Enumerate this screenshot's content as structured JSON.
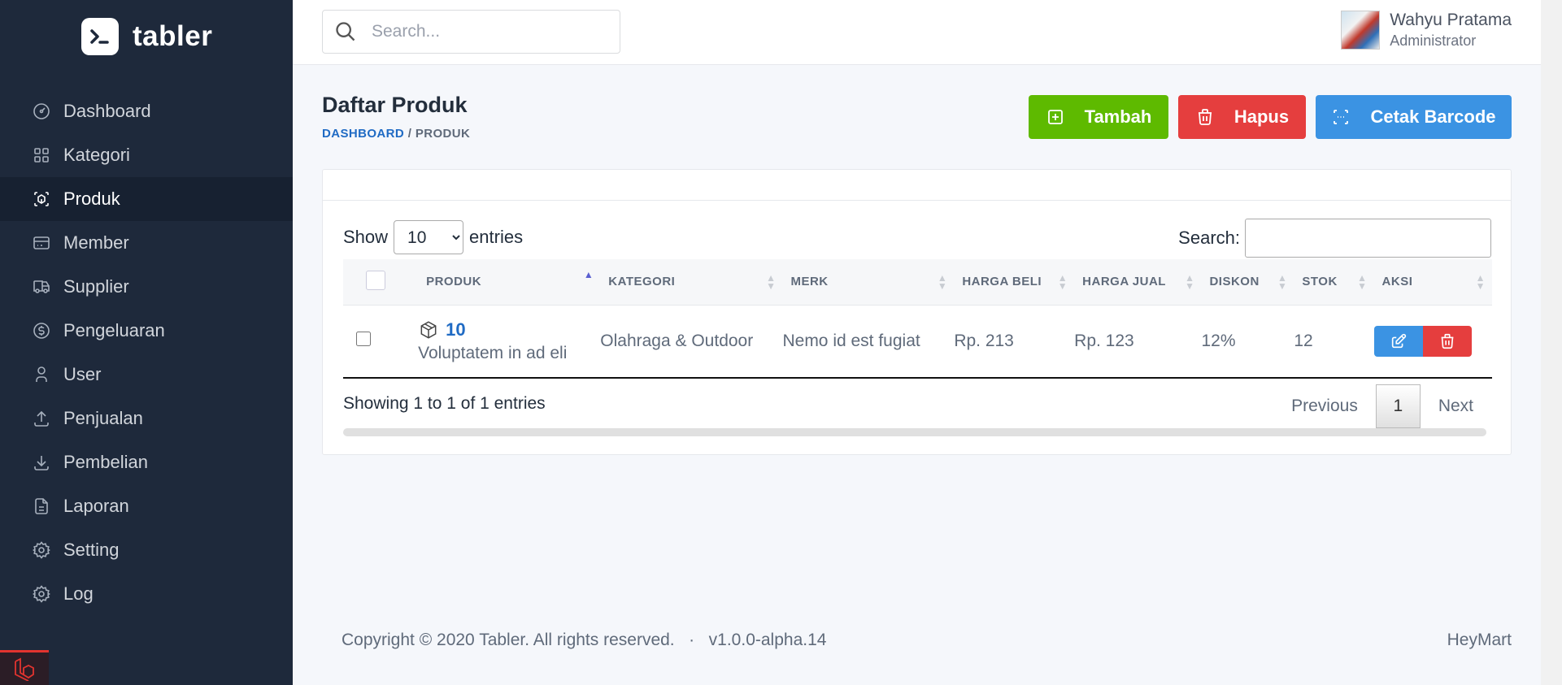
{
  "brand": {
    "name": "tabler"
  },
  "sidebar": {
    "items": [
      {
        "label": "Dashboard",
        "icon": "dashboard-icon"
      },
      {
        "label": "Kategori",
        "icon": "grid-icon"
      },
      {
        "label": "Produk",
        "icon": "box-icon",
        "active": true
      },
      {
        "label": "Member",
        "icon": "card-icon"
      },
      {
        "label": "Supplier",
        "icon": "truck-icon"
      },
      {
        "label": "Pengeluaran",
        "icon": "coin-icon"
      },
      {
        "label": "User",
        "icon": "user-icon"
      },
      {
        "label": "Penjualan",
        "icon": "upload-icon"
      },
      {
        "label": "Pembelian",
        "icon": "download-icon"
      },
      {
        "label": "Laporan",
        "icon": "file-icon"
      },
      {
        "label": "Setting",
        "icon": "gear-icon"
      },
      {
        "label": "Log",
        "icon": "gear-icon"
      }
    ]
  },
  "header": {
    "search_placeholder": "Search...",
    "user": {
      "name": "Wahyu Pratama",
      "role": "Administrator"
    }
  },
  "page": {
    "title": "Daftar Produk",
    "breadcrumb": {
      "link": "DASHBOARD",
      "sep": "/",
      "current": "PRODUK"
    },
    "buttons": {
      "tambah": "Tambah",
      "hapus": "Hapus",
      "cetak": "Cetak Barcode"
    }
  },
  "table": {
    "show_label": "Show",
    "entries_label": "entries",
    "length_value": "10",
    "search_label": "Search:",
    "columns": [
      "PRODUK",
      "KATEGORI",
      "MERK",
      "HARGA BELI",
      "HARGA JUAL",
      "DISKON",
      "STOK",
      "AKSI"
    ],
    "rows": [
      {
        "code": "10",
        "name": "Voluptatem in ad eli",
        "kategori": "Olahraga & Outdoor",
        "merk": "Nemo id est fugiat",
        "harga_beli": "Rp. 213",
        "harga_jual": "Rp. 123",
        "diskon": "12%",
        "stok": "12"
      }
    ],
    "info": "Showing 1 to 1 of 1 entries",
    "pagination": {
      "previous": "Previous",
      "current": "1",
      "next": "Next"
    }
  },
  "footer": {
    "copyright": "Copyright © 2020 Tabler. All rights reserved.",
    "separator": "·",
    "version": "v1.0.0-alpha.14",
    "brand": "HeyMart"
  },
  "colors": {
    "sidebar": "#1e293b",
    "primary": "#206bc4",
    "success": "#5eba00",
    "danger": "#e53e3e",
    "info": "#3b93e3"
  }
}
